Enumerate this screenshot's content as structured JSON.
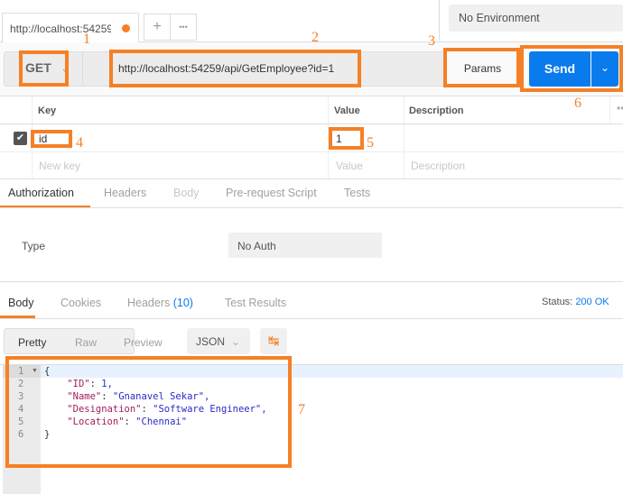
{
  "tabs": {
    "active_tab": "http://localhost:54259",
    "add": "+",
    "more": "•••"
  },
  "environment": {
    "selected": "No Environment"
  },
  "request": {
    "method": "GET",
    "url": "http://localhost:54259/api/GetEmployee?id=1",
    "params_label": "Params",
    "send_label": "Send"
  },
  "params": {
    "headers": [
      "Key",
      "Value",
      "Description"
    ],
    "rows": [
      {
        "key": "id",
        "value": "1",
        "checked": true
      }
    ],
    "placeholder": {
      "key": "New key",
      "value": "Value",
      "description": "Description"
    }
  },
  "request_tabs": [
    "Authorization",
    "Headers",
    "Body",
    "Pre-request Script",
    "Tests"
  ],
  "auth": {
    "type_label": "Type",
    "type_value": "No Auth"
  },
  "response_tabs": {
    "body": "Body",
    "cookies": "Cookies",
    "headers": "Headers",
    "headers_count": "(10)",
    "tests": "Test Results"
  },
  "status": {
    "label": "Status:",
    "value": "200 OK"
  },
  "view": {
    "pretty": "Pretty",
    "raw": "Raw",
    "preview": "Preview",
    "format": "JSON"
  },
  "response_lines": [
    {
      "n": "1",
      "text": "{"
    },
    {
      "n": "2",
      "key": "\"ID\"",
      "val": "1,"
    },
    {
      "n": "3",
      "key": "\"Name\"",
      "val": "\"Gnanavel Sekar\","
    },
    {
      "n": "4",
      "key": "\"Designation\"",
      "val": "\"Software Engineer\","
    },
    {
      "n": "5",
      "key": "\"Location\"",
      "val": "\"Chennai\""
    },
    {
      "n": "6",
      "text": "}"
    }
  ],
  "annotations": [
    "1",
    "2",
    "3",
    "4",
    "5",
    "6",
    "7"
  ],
  "colors": {
    "accent": "#f58025",
    "send": "#097bed"
  }
}
